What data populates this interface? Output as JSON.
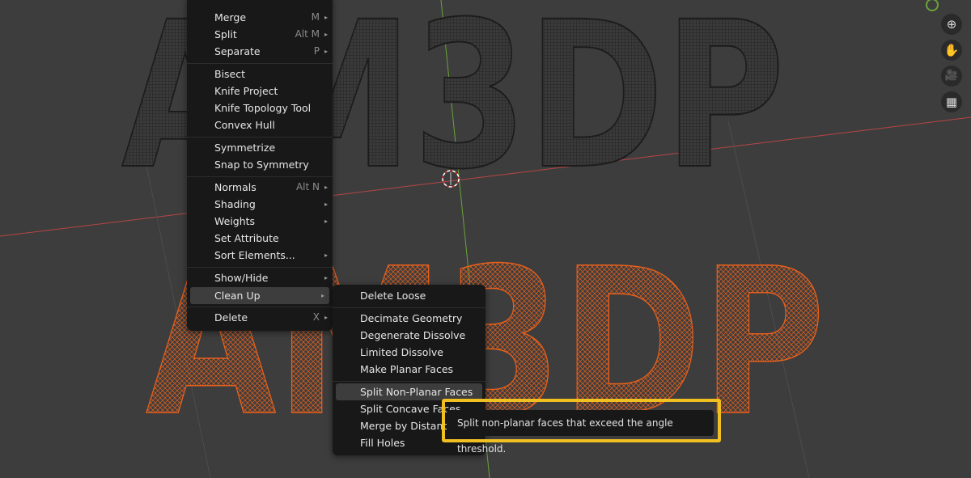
{
  "mesh_menu": {
    "items": [
      {
        "label": "Merge",
        "shortcut": "M",
        "arrow": "▸"
      },
      {
        "label": "Split",
        "shortcut": "Alt M",
        "arrow": "▸"
      },
      {
        "label": "Separate",
        "shortcut": "P",
        "arrow": "▸"
      },
      {
        "label": "Bisect",
        "shortcut": "",
        "arrow": ""
      },
      {
        "label": "Knife Project",
        "shortcut": "",
        "arrow": ""
      },
      {
        "label": "Knife Topology Tool",
        "shortcut": "",
        "arrow": ""
      },
      {
        "label": "Convex Hull",
        "shortcut": "",
        "arrow": ""
      },
      {
        "label": "Symmetrize",
        "shortcut": "",
        "arrow": ""
      },
      {
        "label": "Snap to Symmetry",
        "shortcut": "",
        "arrow": ""
      },
      {
        "label": "Normals",
        "shortcut": "Alt N",
        "arrow": "▸"
      },
      {
        "label": "Shading",
        "shortcut": "",
        "arrow": "▸"
      },
      {
        "label": "Weights",
        "shortcut": "",
        "arrow": "▸"
      },
      {
        "label": "Set Attribute",
        "shortcut": "",
        "arrow": ""
      },
      {
        "label": "Sort Elements...",
        "shortcut": "",
        "arrow": "▸"
      },
      {
        "label": "Show/Hide",
        "shortcut": "",
        "arrow": "▸"
      },
      {
        "label": "Clean Up",
        "shortcut": "",
        "arrow": "▸"
      },
      {
        "label": "Delete",
        "shortcut": "X",
        "arrow": "▸"
      }
    ]
  },
  "cleanup_menu": {
    "items": [
      {
        "label": "Delete Loose"
      },
      {
        "label": "Decimate Geometry"
      },
      {
        "label": "Degenerate Dissolve"
      },
      {
        "label": "Limited Dissolve"
      },
      {
        "label": "Make Planar Faces"
      },
      {
        "label": "Split Non-Planar Faces"
      },
      {
        "label": "Split Concave Faces"
      },
      {
        "label": "Merge by Distance"
      },
      {
        "label": "Fill Holes"
      }
    ]
  },
  "tooltip": {
    "text": "Split non-planar faces that exceed the angle threshold."
  },
  "viewport": {
    "text_top": "AM3DP",
    "text_bottom": "AM3DP",
    "colors": {
      "background": "#3d3d3d",
      "wire_dark": "#2a2a2a",
      "wire_orange": "#e8601c",
      "axis_x": "#b84545",
      "axis_y": "#6aa33a",
      "highlight": "#f0c020"
    }
  },
  "nav_gizmo": {
    "icons": [
      "zoom-icon",
      "hand-icon",
      "camera-icon",
      "grid-icon"
    ],
    "glyphs": [
      "⊕",
      "✋",
      "🎥",
      "▦"
    ]
  }
}
